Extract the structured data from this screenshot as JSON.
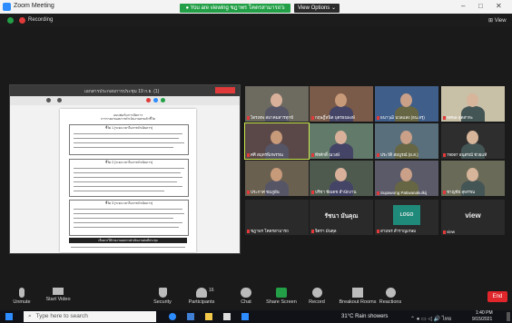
{
  "window": {
    "title": "Zoom Meeting",
    "controls": {
      "minimize": "–",
      "maximize": "□",
      "close": "✕"
    }
  },
  "share_banner": {
    "text": "● You are viewing ชฎาพร โคตรสามารถ's screen",
    "view_options": "View Options ⌄"
  },
  "top_strip": {
    "recording": "Recording",
    "view": "⊞ View"
  },
  "shared_doc": {
    "tab_title": "เอกสารประกอบการประชุม 19 ก.ย. (1)",
    "page_heading_1": "แบบฟอร์มการจัดการ",
    "page_heading_2": "การรายงานผลการดำเนินงานตามตัวชี้วัด",
    "section_1": "ชี้วัด 1 (ระยะเวลาในการดำเนินการ)",
    "section_2": "ชี้วัด 2 (ระยะเวลาในการดำเนินการ)",
    "section_3": "ชี้วัด 3 (ระยะเวลาในการดำเนินการ)",
    "footer_note": "เห็นควรให้รายงานผลการดำเนินงานต่อที่ประชุม"
  },
  "participants": [
    {
      "name": "ไตรเทพ สมาคมสารทุกข์"
    },
    {
      "name": "กฤษฎิ์หนิต บุตรธนพงษ์"
    },
    {
      "name": "ธนาวุฒิ นวลแสง (ธน.สรุ)"
    },
    {
      "name": "ทศพล อุตสาหะ"
    },
    {
      "name": "ศศิ สมุทรพิภพรรณ"
    },
    {
      "name": "พีรศักดิ์ ณวงษ์"
    },
    {
      "name": "ประวัติ สมบูรณ์ (ผ.ส.)"
    },
    {
      "name": "79097 อนุสรณ์ ช่วยแท้"
    },
    {
      "name": "ประกาศ ชมภูผัน"
    },
    {
      "name": "ปรีชา ชัยเดช สำนักงาน"
    },
    {
      "name": "Supawong Patiwanakulkij"
    },
    {
      "name": "ชาญชัย สุพรรณ"
    },
    {
      "name": "ชฎาพร โคตรสามารถ",
      "label": ""
    },
    {
      "name": "จิตรา มันคุล",
      "label": "รัชนา มันคุณ"
    },
    {
      "name": "สามพร สำราญเกษม",
      "label": "LOGO"
    },
    {
      "name": "view",
      "label": "view"
    }
  ],
  "toolbar": {
    "unmute": "Unmute",
    "start_video": "Start Video",
    "security": "Security",
    "participants": "Participants",
    "participants_count": "16",
    "chat": "Chat",
    "share_screen": "Share Screen",
    "record": "Record",
    "breakout": "Breakout Rooms",
    "reactions": "Reactions",
    "end": "End"
  },
  "taskbar": {
    "search_placeholder": "Type here to search",
    "weather": "31°C Rain showers",
    "time": "1:40 PM",
    "date": "9/15/2021"
  },
  "colors": {
    "share_green": "#23a047",
    "end_red": "#e0262b",
    "zoom_blue": "#2d8cff"
  }
}
